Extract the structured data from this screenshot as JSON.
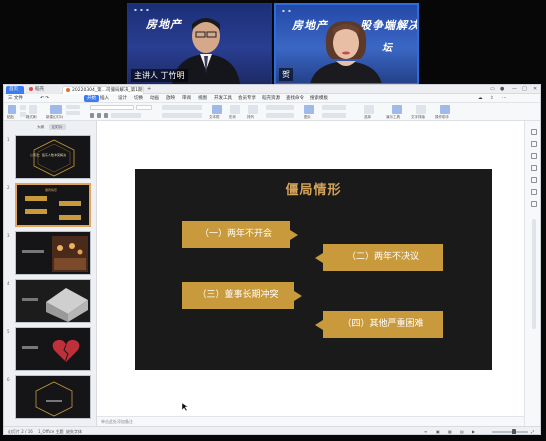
{
  "video": {
    "tile1": {
      "title": "房地产",
      "subtitle": "",
      "nametag": "主讲人 丁竹明"
    },
    "tile2": {
      "title": "房地产",
      "title_tail": "股争端解决",
      "subtitle": "坛",
      "nametag": "贺"
    }
  },
  "app": {
    "tabs": [
      {
        "label": "首页"
      },
      {
        "label": "稻壳"
      },
      {
        "label": "20220304_第...司僵局解决_第1期"
      }
    ],
    "menu": [
      "三 文件",
      "开始",
      "插入",
      "设计",
      "切换",
      "动画",
      "放映",
      "审阅",
      "视图",
      "开发工具",
      "会员专享",
      "稻壳资源",
      "查找命令",
      "搜索模板"
    ],
    "ribbon_labels": [
      "格式刷",
      "粘贴",
      "新建幻灯片",
      "版式",
      "节",
      "重置",
      "文本框",
      "形状",
      "排列",
      "查找",
      "替换",
      "选择",
      "图片",
      "演示工具",
      "文字排版",
      "操作助手"
    ],
    "panel_tabs": [
      "大纲",
      "幻灯片"
    ],
    "thumbnails": [
      {
        "num": "1",
        "text": "公司法：股东人数冲突解决"
      },
      {
        "num": "2",
        "text": "僵局情形"
      },
      {
        "num": "3",
        "text": ""
      },
      {
        "num": "4",
        "text": ""
      },
      {
        "num": "5",
        "text": ""
      },
      {
        "num": "6",
        "text": ""
      }
    ],
    "notes_placeholder": "单击此处添加备注",
    "status": {
      "slide_of": "幻灯片 2 / 16",
      "theme": "1_Office 主题",
      "font_warn": "缺失字体"
    }
  },
  "slide": {
    "title": "僵局情形",
    "items": [
      "（一）两年不开会",
      "（二）两年不决议",
      "（三）董事长期冲突",
      "（四）其他严重困难"
    ]
  },
  "colors": {
    "gold": "#c89a3c",
    "title_gold": "#d3a35a",
    "slide_bg": "#1a1a1a",
    "accent_blue": "#3c7cf0"
  }
}
